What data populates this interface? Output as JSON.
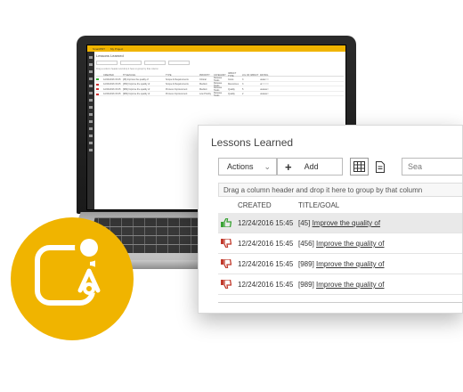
{
  "laptop": {
    "tabs": [
      "SmartPDT",
      "My Project"
    ],
    "title": "Lessons Learned",
    "toolbar": [
      "Actions",
      "Add",
      "Search",
      "Filter"
    ],
    "hint": "Drag a column header and drop it here to group by that column",
    "columns": [
      "",
      "CREATED",
      "TITLE/GOAL",
      "TYPE",
      "PRIORITY",
      "CATEGORY",
      "IMPACT TYPE",
      "LVL OF IMPACT",
      "RATING"
    ],
    "rows": [
      {
        "created": "12/24/2016 15:45",
        "title": "[45] Improve the quality of",
        "type": "Scope & Requirements",
        "priority": "Critical",
        "category": "Release Tasks",
        "impact": "Costs",
        "level": "3",
        "rating": "★★★☆☆",
        "positive": true
      },
      {
        "created": "12/24/2016 15:45",
        "title": "[456] Improve the quality of",
        "type": "Scope & Requirements",
        "priority": "Medium",
        "category": "Release Tasks",
        "impact": "Resources",
        "level": "3",
        "rating": "★☆☆☆☆",
        "positive": false
      },
      {
        "created": "12/24/2016 15:45",
        "title": "[989] Improve the quality of",
        "type": "Process Improvement",
        "priority": "Medium",
        "category": "Release Tasks",
        "impact": "Quality",
        "level": "5",
        "rating": "★★★★☆",
        "positive": false
      },
      {
        "created": "12/24/2016 15:45",
        "title": "[989] Improve the quality of",
        "type": "Process Improvement",
        "priority": "Low Priority",
        "category": "Release Tasks",
        "impact": "Quality",
        "level": "2",
        "rating": "★★★★☆",
        "positive": false
      }
    ]
  },
  "panel": {
    "title": "Lessons Learned",
    "actions_label": "Actions",
    "add_label": "Add",
    "search_placeholder": "Sea",
    "group_hint": "Drag a column header and drop it here to group by that column",
    "col_created": "CREATED",
    "col_title": "TITLE/GOAL",
    "rows": [
      {
        "created": "12/24/2016 15:45",
        "id": "[45]",
        "title": "Improve the quality of",
        "thumb": "thumbs-up-icon",
        "color": "#3aa335"
      },
      {
        "created": "12/24/2016 15:45",
        "id": "[456]",
        "title": "Improve the quality of",
        "thumb": "thumbs-down-icon",
        "color": "#c0392b"
      },
      {
        "created": "12/24/2016 15:45",
        "id": "[989]",
        "title": "Improve the quality of",
        "thumb": "thumbs-down-icon",
        "color": "#c0392b"
      },
      {
        "created": "12/24/2016 15:45",
        "id": "[989]",
        "title": "Improve the quality of",
        "thumb": "thumbs-down-icon",
        "color": "#c0392b"
      }
    ]
  },
  "colors": {
    "accent": "#f0b400",
    "selected_row": "#e9e9e9"
  }
}
